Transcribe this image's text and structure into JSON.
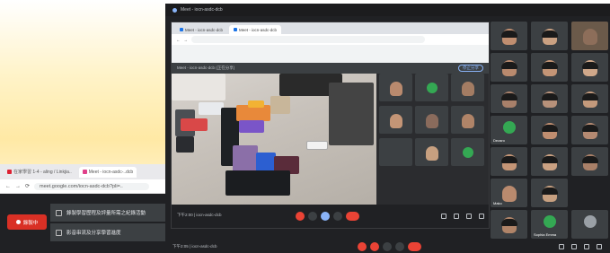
{
  "background_browser": {
    "tabs": [
      {
        "label": "在家學習 1-4 - aling / Linkjia..",
        "active": false
      },
      {
        "label": "Meet - iocn-asdc-..dcb",
        "active": true
      }
    ],
    "address": "meet.google.com/iocn-asdc-dcb?pli=..",
    "record_label": "錄製中",
    "menu_items": [
      "錄製學習歷程及評量所需之紀錄活動",
      "影音串流及分享學習進度"
    ]
  },
  "meet_window": {
    "title": "Meet - iocn-asdc-dcb",
    "shared_screen": {
      "tabs": [
        "Meet - iocn-asdc-dcb",
        "Meet - iocn-asdc-dcb"
      ],
      "header_label": "Meet - iocn-asdc-dcb (正在分享)",
      "stop_share_label": "停止分享",
      "meeting_info": "下午2:00 | iocn-asdc-dcb"
    },
    "meeting_info": "下午2:05 | iocn-asdc-dcb"
  },
  "participant_names": [
    "Dezaro",
    "Mako",
    "Sophia Emma"
  ],
  "colors": {
    "meet_bg": "#202124",
    "tile_bg": "#3c4043",
    "end_call": "#ea4335",
    "accent": "#8ab4f8",
    "avatar_green": "#34a853"
  }
}
